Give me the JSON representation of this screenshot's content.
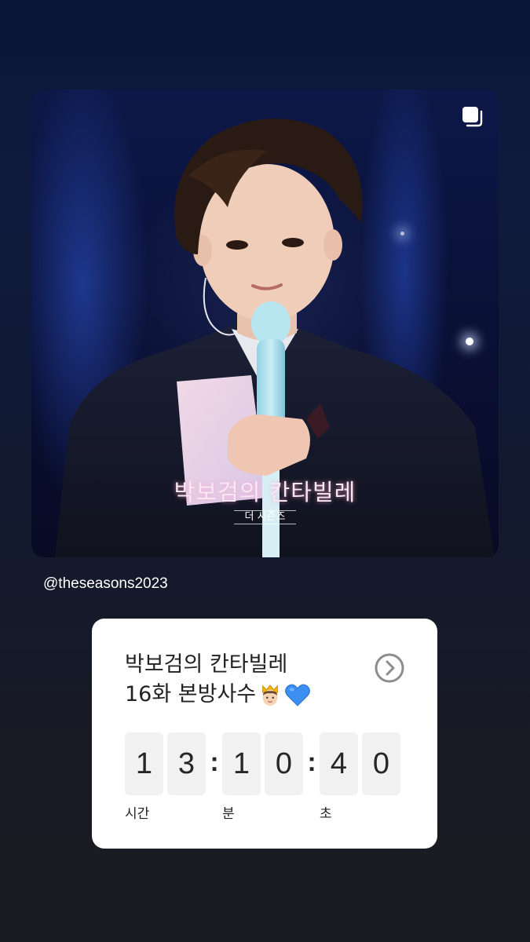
{
  "post": {
    "show_logo_title": "박보검의 칸타빌레",
    "show_logo_subtitle": "더 시즌즈",
    "multiple_icon": "multiple-posts-icon"
  },
  "username": "@theseasons2023",
  "countdown": {
    "title_line1": "박보검의 칸타빌레",
    "title_line2": "16화 본방사수",
    "emojis": [
      "crown-person-icon",
      "blue-heart-icon"
    ],
    "hours": [
      "1",
      "3"
    ],
    "minutes": [
      "1",
      "0"
    ],
    "seconds": [
      "4",
      "0"
    ],
    "separator": ":",
    "labels": {
      "hours": "시간",
      "minutes": "분",
      "seconds": "초"
    },
    "button_icon": "chevron-right-circle-icon"
  },
  "colors": {
    "heart": "#3b8ff0",
    "card_bg": "#ffffff",
    "digit_bg": "#f1f1f1"
  }
}
